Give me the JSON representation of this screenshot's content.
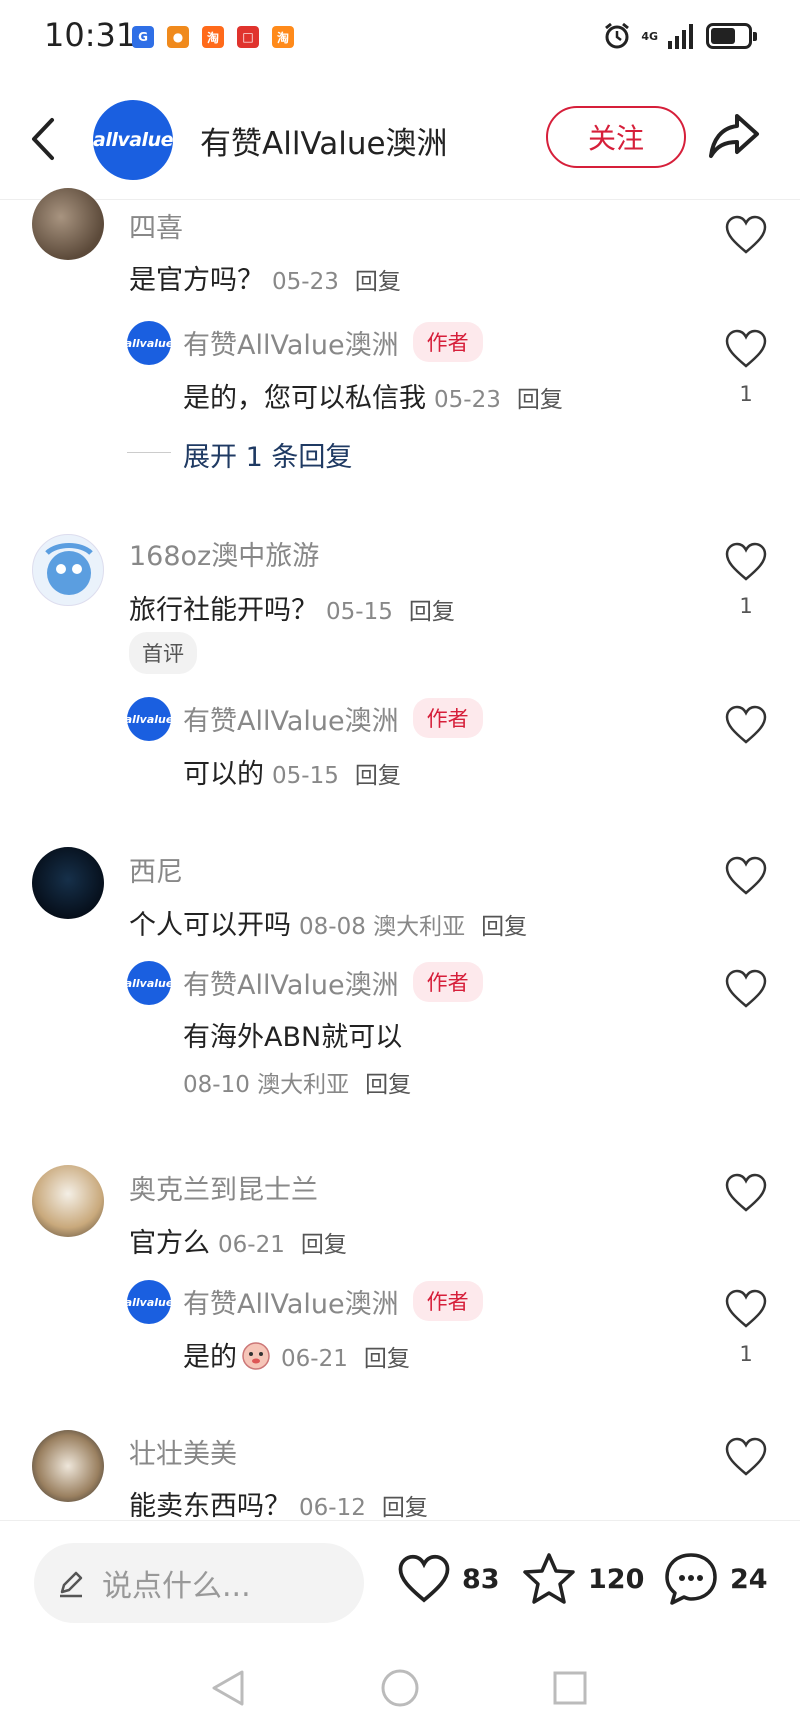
{
  "status_bar": {
    "time": "10:31",
    "apps": [
      {
        "glyph": "G",
        "color": "#2f6fe6"
      },
      {
        "glyph": "●",
        "color": "#f08a1c"
      },
      {
        "glyph": "淘",
        "color": "#ff6a1a"
      },
      {
        "glyph": "□",
        "color": "#e0332d"
      },
      {
        "glyph": "淘",
        "color": "#ff8a1a"
      }
    ],
    "network": "4G",
    "icons": [
      "alarm-icon",
      "signal-icon",
      "battery-icon"
    ]
  },
  "header": {
    "avatar_text": "allvalue",
    "title": "有赞AllValue澳洲",
    "follow_label": "关注"
  },
  "comments": [
    {
      "user": "四喜",
      "text": "是官方吗？",
      "date": "05-23",
      "reply_label": "回复",
      "likes": "",
      "reply": {
        "user": "有赞AllValue澳洲",
        "badge": "作者",
        "text": "是的，您可以私信我",
        "date": "05-23",
        "reply_label": "回复",
        "likes": "1"
      },
      "expand": "展开 1 条回复"
    },
    {
      "user": "168oz澳中旅游",
      "text": "旅行社能开吗？",
      "date": "05-15",
      "reply_label": "回复",
      "likes": "1",
      "tag": "首评",
      "reply": {
        "user": "有赞AllValue澳洲",
        "badge": "作者",
        "text": "可以的",
        "date": "05-15",
        "reply_label": "回复",
        "likes": ""
      }
    },
    {
      "user": "西尼",
      "text": "个人可以开吗",
      "date": "08-08 澳大利亚",
      "reply_label": "回复",
      "likes": "",
      "reply": {
        "user": "有赞AllValue澳洲",
        "badge": "作者",
        "text": "有海外ABN就可以",
        "date": "08-10 澳大利亚",
        "reply_label": "回复",
        "likes": ""
      }
    },
    {
      "user": "奥克兰到昆士兰",
      "text": "官方么",
      "date": "06-21",
      "reply_label": "回复",
      "likes": "",
      "reply": {
        "user": "有赞AllValue澳洲",
        "badge": "作者",
        "text": "是的",
        "date": "06-21",
        "reply_label": "回复",
        "likes": "1"
      }
    },
    {
      "user": "壮壮美美",
      "text": "能卖东西吗？",
      "date": "06-12",
      "reply_label": "回复",
      "likes": ""
    }
  ],
  "bottom_bar": {
    "input_placeholder": "说点什么...",
    "likes": "83",
    "favorites": "120",
    "comments": "24"
  }
}
